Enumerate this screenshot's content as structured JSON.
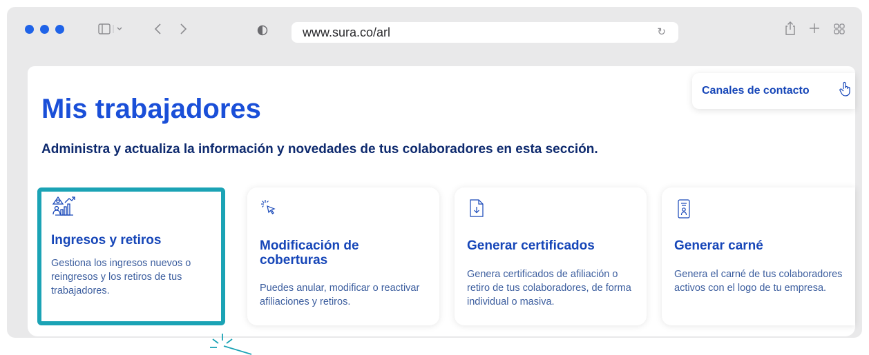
{
  "browser": {
    "url": "www.sura.co/arl"
  },
  "header": {
    "contact_label": "Canales de contacto"
  },
  "main": {
    "title": "Mis trabajadores",
    "subtitle": "Administra y actualiza la información y novedades de tus colaboradores en esta sección."
  },
  "cards": [
    {
      "title": "Ingresos y retiros",
      "description": "Gestiona los ingresos nuevos o reingresos y los retiros de tus trabajadores.",
      "icon": "chart-people-icon"
    },
    {
      "title": "Modificación de coberturas",
      "description": "Puedes anular, modificar o reactivar afiliaciones y retiros.",
      "icon": "cursor-click-icon"
    },
    {
      "title": "Generar certificados",
      "description": "Genera certificados de afiliación o retiro de tus colaboradores, de forma individual o masiva.",
      "icon": "document-download-icon"
    },
    {
      "title": "Generar carné",
      "description": "Genera el carné de tus colaboradores activos con el logo de tu empresa.",
      "icon": "id-card-icon"
    }
  ],
  "colors": {
    "brand_blue": "#1a4fd8",
    "highlight_teal": "#1ba3b5",
    "traffic_light": "#1f63e8"
  }
}
